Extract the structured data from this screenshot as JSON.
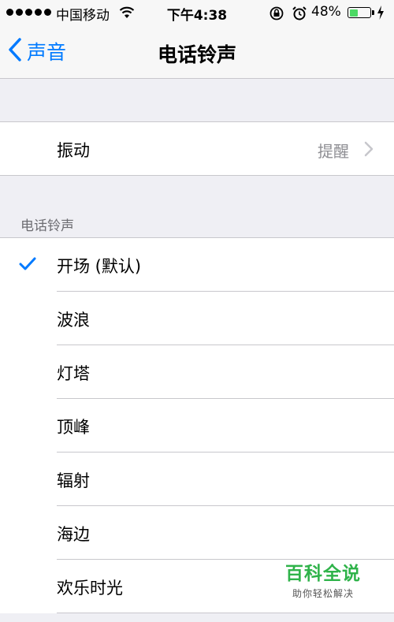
{
  "status_bar": {
    "carrier": "中国移动",
    "time": "下午4:38",
    "battery_percent": "48%",
    "battery_level": 0.48,
    "battery_color": "#4cd964"
  },
  "nav": {
    "back_label": "声音",
    "title": "电话铃声",
    "accent_color": "#007aff"
  },
  "vibration": {
    "label": "振动",
    "value": "提醒"
  },
  "ringtones": {
    "section_header": "电话铃声",
    "items": [
      {
        "label": "开场 (默认)",
        "selected": true
      },
      {
        "label": "波浪",
        "selected": false
      },
      {
        "label": "灯塔",
        "selected": false
      },
      {
        "label": "顶峰",
        "selected": false
      },
      {
        "label": "辐射",
        "selected": false
      },
      {
        "label": "海边",
        "selected": false
      },
      {
        "label": "欢乐时光",
        "selected": false
      }
    ]
  },
  "watermark": {
    "title": "百科全说",
    "subtitle": "助你轻松解决"
  }
}
